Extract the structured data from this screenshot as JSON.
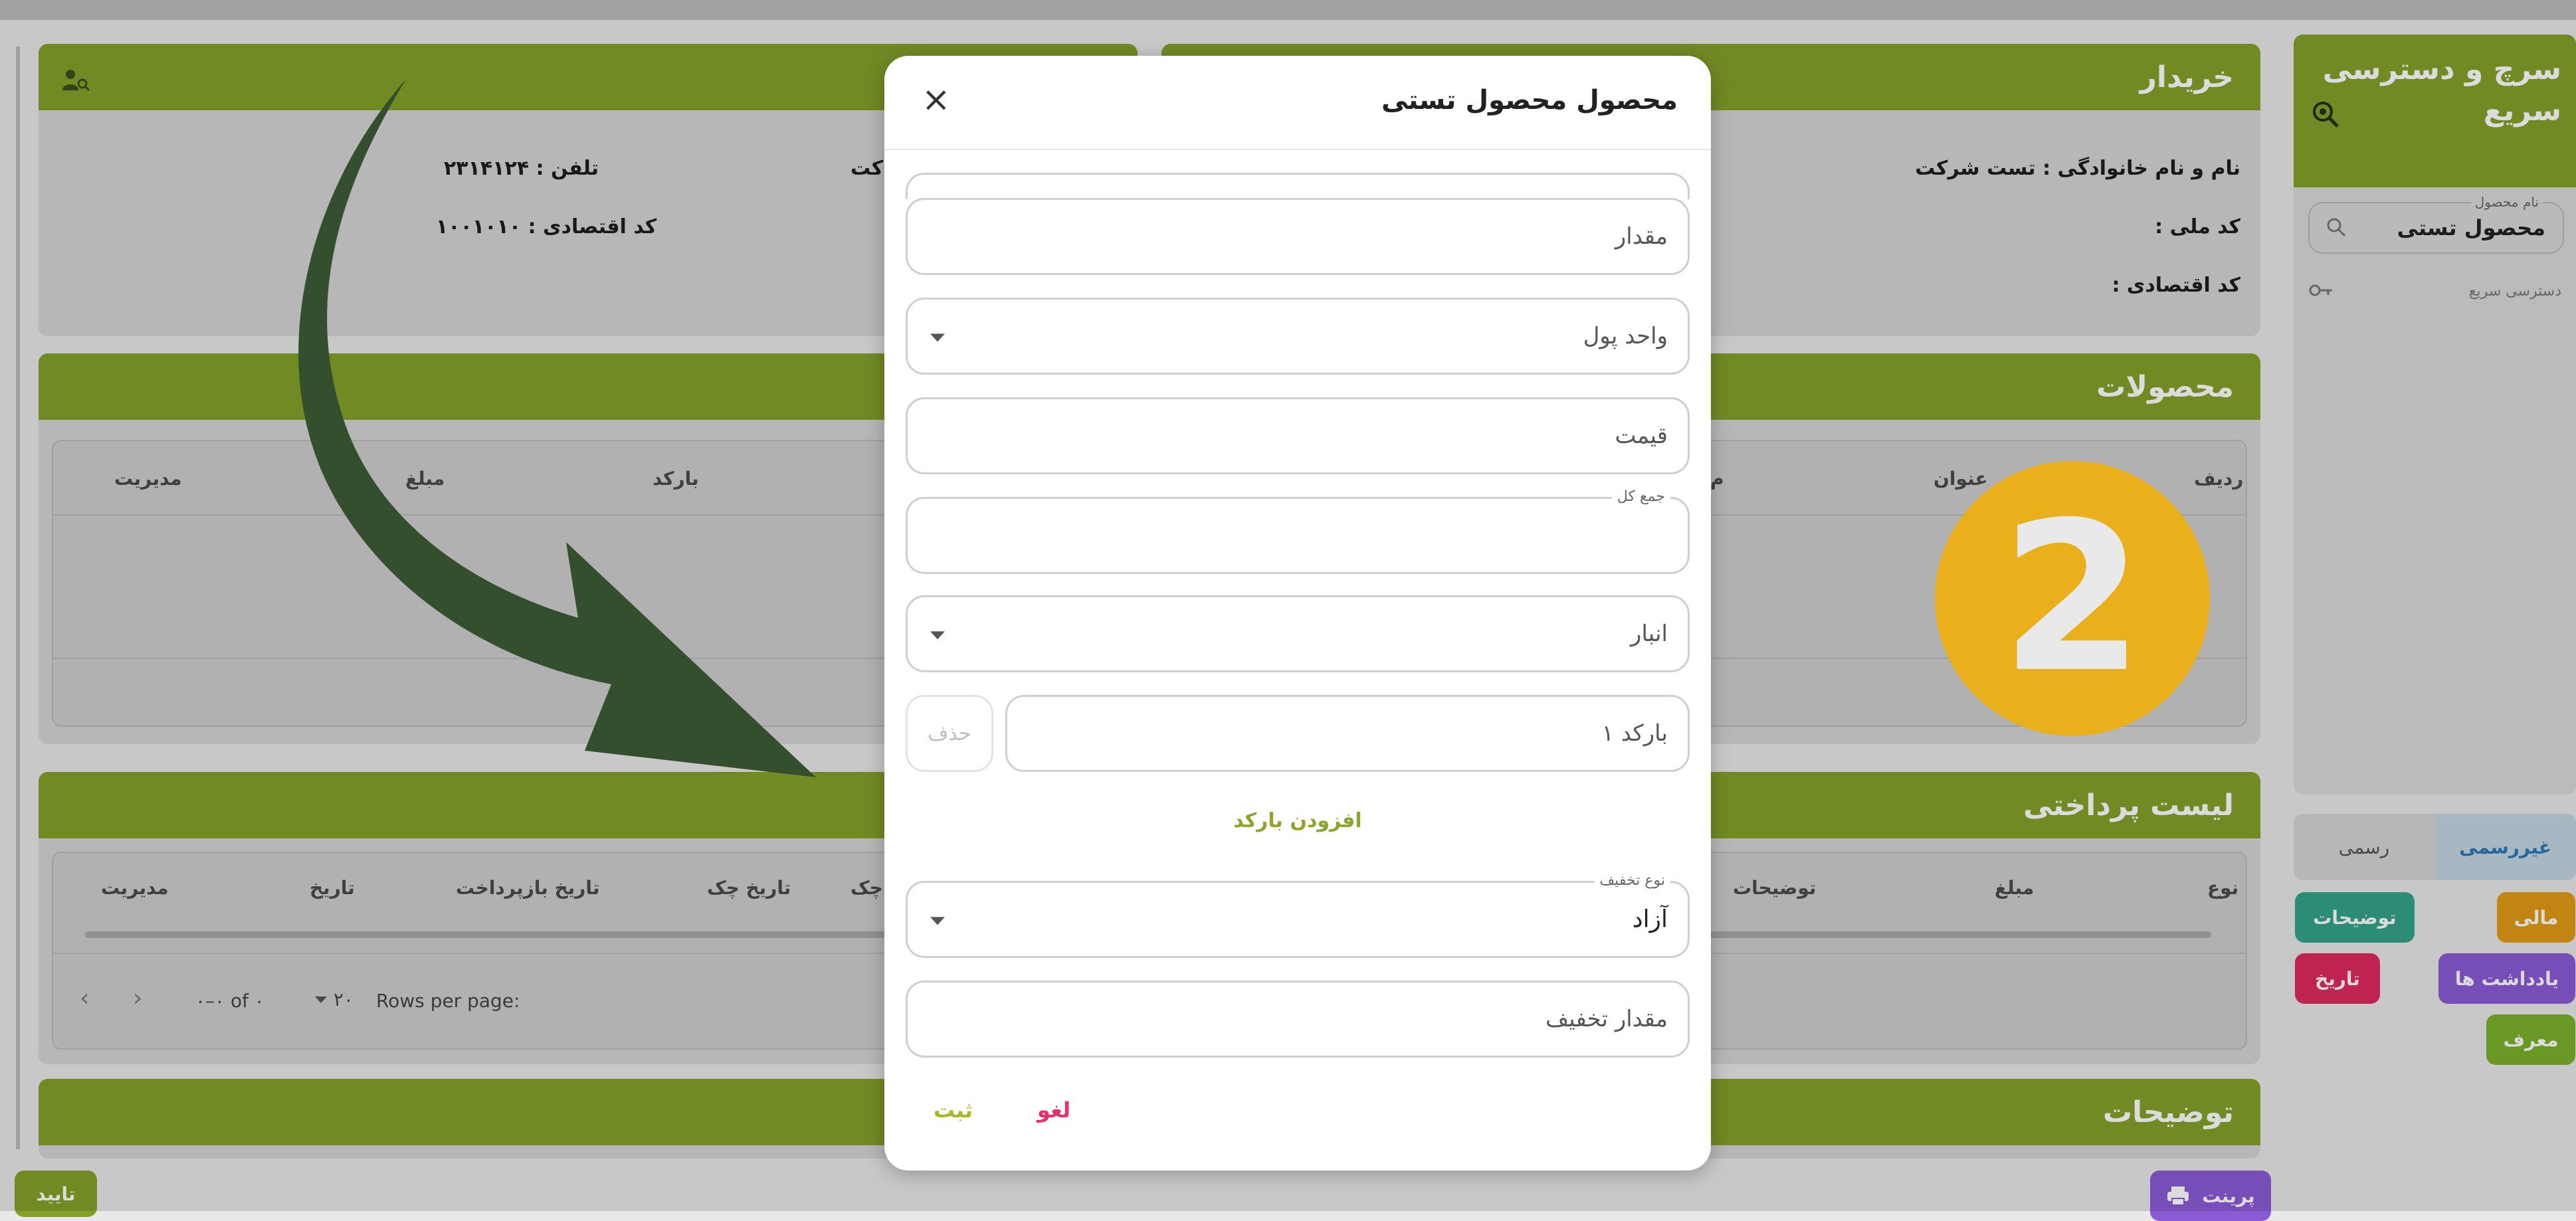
{
  "sidebar": {
    "title_line1": "سرچ و دسترسی",
    "title_line2": "سریع",
    "product_name_label": "نام محصول",
    "product_name_value": "محصول تستی",
    "quick_access_label": "دسترسی سریع",
    "tab_informal": "غیررسمی",
    "tab_formal": "رسمی",
    "btn_financial": "مالی",
    "btn_descriptions": "توضیحات",
    "btn_notes": "یادداشت ها",
    "btn_date": "تاریخ",
    "btn_referrer": "معرف"
  },
  "buyer": {
    "title": "خریدار",
    "name_line": "نام و نام خانوادگی : تست شرکت",
    "national_code": "کد ملی :",
    "economic_code": "کد اقتصادی :",
    "phone": "تلفن : ۲۳۱۴۱۲۴",
    "seller_economic_code": "کد اقتصادی : ۱۰۰۱۰۱۰",
    "partial_text": "کت"
  },
  "products": {
    "title": "محصولات",
    "columns": [
      "ردیف",
      "عنوان",
      "م",
      "بارکد",
      "مبلغ",
      "مدیریت"
    ]
  },
  "payments": {
    "title": "لیست پرداختی",
    "columns": [
      "نوع",
      "مبلغ",
      "توضیحات",
      "چک",
      "تاریخ چک",
      "تاریخ بازپرداخت",
      "تاریخ",
      "مدیریت"
    ],
    "rows_per_page_label": "Rows per page:",
    "rows_per_page_value": "۲۰",
    "range_text": "۰–۰ of ۰"
  },
  "descriptions": {
    "title": "توضیحات"
  },
  "footer": {
    "print_label": "پرینت",
    "confirm_label": "تایید"
  },
  "modal": {
    "title": "محصول محصول تستی",
    "close_symbol": "×",
    "amount_placeholder": "مقدار",
    "currency_placeholder": "واحد پول",
    "price_placeholder": "قیمت",
    "total_label": "جمع کل",
    "warehouse_placeholder": "انبار",
    "barcode_placeholder": "بارکد ۱",
    "delete_label": "حذف",
    "add_barcode_label": "افزودن بارکد",
    "discount_type_label": "نوع تخفیف",
    "discount_type_value": "آزاد",
    "discount_amount_placeholder": "مقدار تخفیف",
    "cancel_label": "لغو",
    "submit_label": "ثبت"
  },
  "annotation": {
    "step_number": "2"
  },
  "colors": {
    "green": "#84a12a",
    "yellow_badge": "#eab01b",
    "arrow": "#344f2e",
    "purple": "#8b5bd6",
    "pink_cancel": "#e8306a"
  }
}
